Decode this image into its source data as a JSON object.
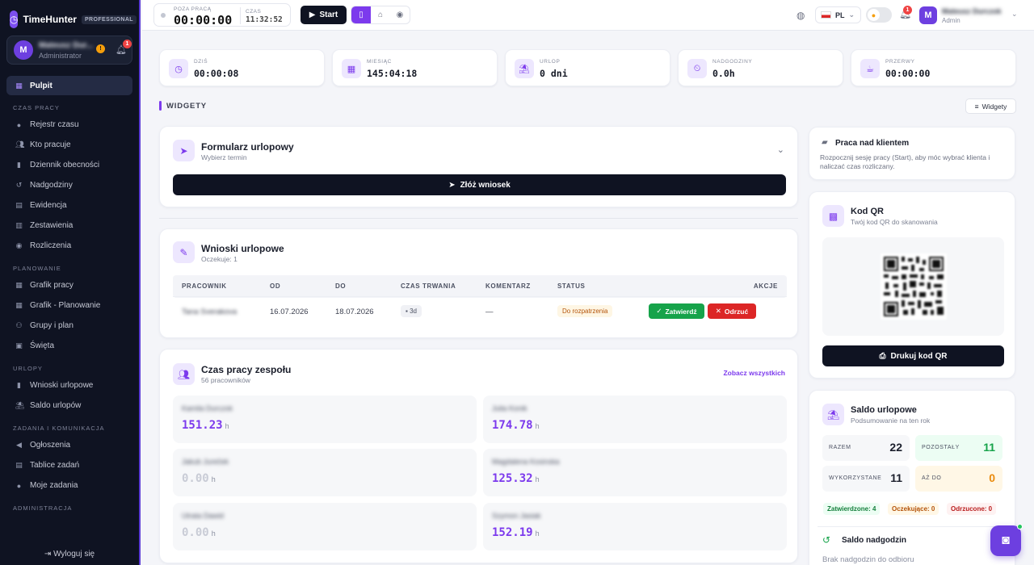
{
  "brand": {
    "name": "TimeHunter",
    "tag": "PROFESSIONAL",
    "logo": "M"
  },
  "sidebar_user": {
    "initial": "M",
    "name": "Mateusz Dur...",
    "role": "Administrator",
    "warn": "!",
    "notif": "1"
  },
  "nav": {
    "pulpit": "Pulpit",
    "sec_czas": "CZAS PRACY",
    "rejestr": "Rejestr czasu",
    "kto": "Kto pracuje",
    "dziennik": "Dziennik obecności",
    "nadgodziny": "Nadgodziny",
    "ewidencja": "Ewidencja",
    "zestawienia": "Zestawienia",
    "rozliczenia": "Rozliczenia",
    "sec_plan": "PLANOWANIE",
    "grafik": "Grafik pracy",
    "grafik_plan": "Grafik - Planowanie",
    "grupy": "Grupy i plan",
    "swieta": "Święta",
    "sec_urlopy": "URLOPY",
    "wnioski": "Wnioski urlopowe",
    "saldo": "Saldo urlopów",
    "sec_zadania": "ZADANIA I KOMUNIKACJA",
    "ogloszenia": "Ogłoszenia",
    "tablice": "Tablice zadań",
    "moje": "Moje zadania",
    "sec_admin": "ADMINISTRACJA",
    "logout": "Wyloguj się"
  },
  "topbar": {
    "status_label": "POZA PRACĄ",
    "timer": "00:00:00",
    "time_label": "CZAS",
    "clock": "11:32:52",
    "start": "Start",
    "lang": "PL",
    "notif": "1",
    "user_initial": "M",
    "user_name": "Mateusz Durczok",
    "user_role": "Admin"
  },
  "stats": [
    {
      "label": "DZIŚ",
      "value": "00:00:08"
    },
    {
      "label": "MIESIĄC",
      "value": "145:04:18"
    },
    {
      "label": "URLOP",
      "value": "0 dni"
    },
    {
      "label": "NADGODZINY",
      "value": "0.0h"
    },
    {
      "label": "PRZERWY",
      "value": "00:00:00"
    }
  ],
  "widgets": {
    "title": "WIDGETY",
    "button": "Widgety"
  },
  "leave_form": {
    "title": "Formularz urlopowy",
    "subtitle": "Wybierz termin",
    "submit": "Złóż wniosek"
  },
  "leave_requests": {
    "title": "Wnioski urlopowe",
    "subtitle": "Oczekuje: 1",
    "headers": [
      "PRACOWNIK",
      "OD",
      "DO",
      "CZAS TRWANIA",
      "KOMENTARZ",
      "STATUS",
      "AKCJE"
    ],
    "row": {
      "employee": "Tana Sverakova",
      "from": "16.07.2026",
      "to": "18.07.2026",
      "duration": "3d",
      "comment": "—",
      "status": "Do rozpatrzenia",
      "approve": "Zatwierdź",
      "reject": "Odrzuć"
    }
  },
  "team": {
    "title": "Czas pracy zespołu",
    "subtitle": "56 pracowników",
    "link": "Zobacz wszystkich",
    "unit": "h",
    "members": [
      {
        "name": "Kamila Durczok",
        "hours": "151.23"
      },
      {
        "name": "Julia Konik",
        "hours": "174.78"
      },
      {
        "name": "Jakub Jureček",
        "hours": "0.00"
      },
      {
        "name": "Magdalena Kosinska",
        "hours": "125.32"
      },
      {
        "name": "Utrata Dawid",
        "hours": "0.00"
      },
      {
        "name": "Szymon Jasiak",
        "hours": "152.19"
      }
    ]
  },
  "client": {
    "title": "Praca nad klientem",
    "text": "Rozpocznij sesję pracy (Start), aby móc wybrać klienta i naliczać czas rozliczany."
  },
  "qr": {
    "title": "Kod QR",
    "subtitle": "Twój kod QR do skanowania",
    "print": "Drukuj kod QR"
  },
  "balance": {
    "title": "Saldo urlopowe",
    "subtitle": "Podsumowanie na ten rok",
    "razem_label": "RAZEM",
    "razem": "22",
    "pozostaly_label": "POZOSTAŁY",
    "pozostaly": "11",
    "wykorzystane_label": "WYKORZYSTANE",
    "wykorzystane": "11",
    "azdo_label": "AŻ DO",
    "azdo": "0",
    "approved": "Zatwierdzone: 4",
    "pending": "Oczekujące: 0",
    "rejected": "Odrzucone: 0"
  },
  "overtime": {
    "title": "Saldo nadgodzin",
    "text": "Brak nadgodzin do odbioru"
  },
  "colors": {
    "accent": "#7c3aed",
    "sidebar": "#0f1322",
    "approve": "#16a34a",
    "reject": "#dc2626"
  }
}
